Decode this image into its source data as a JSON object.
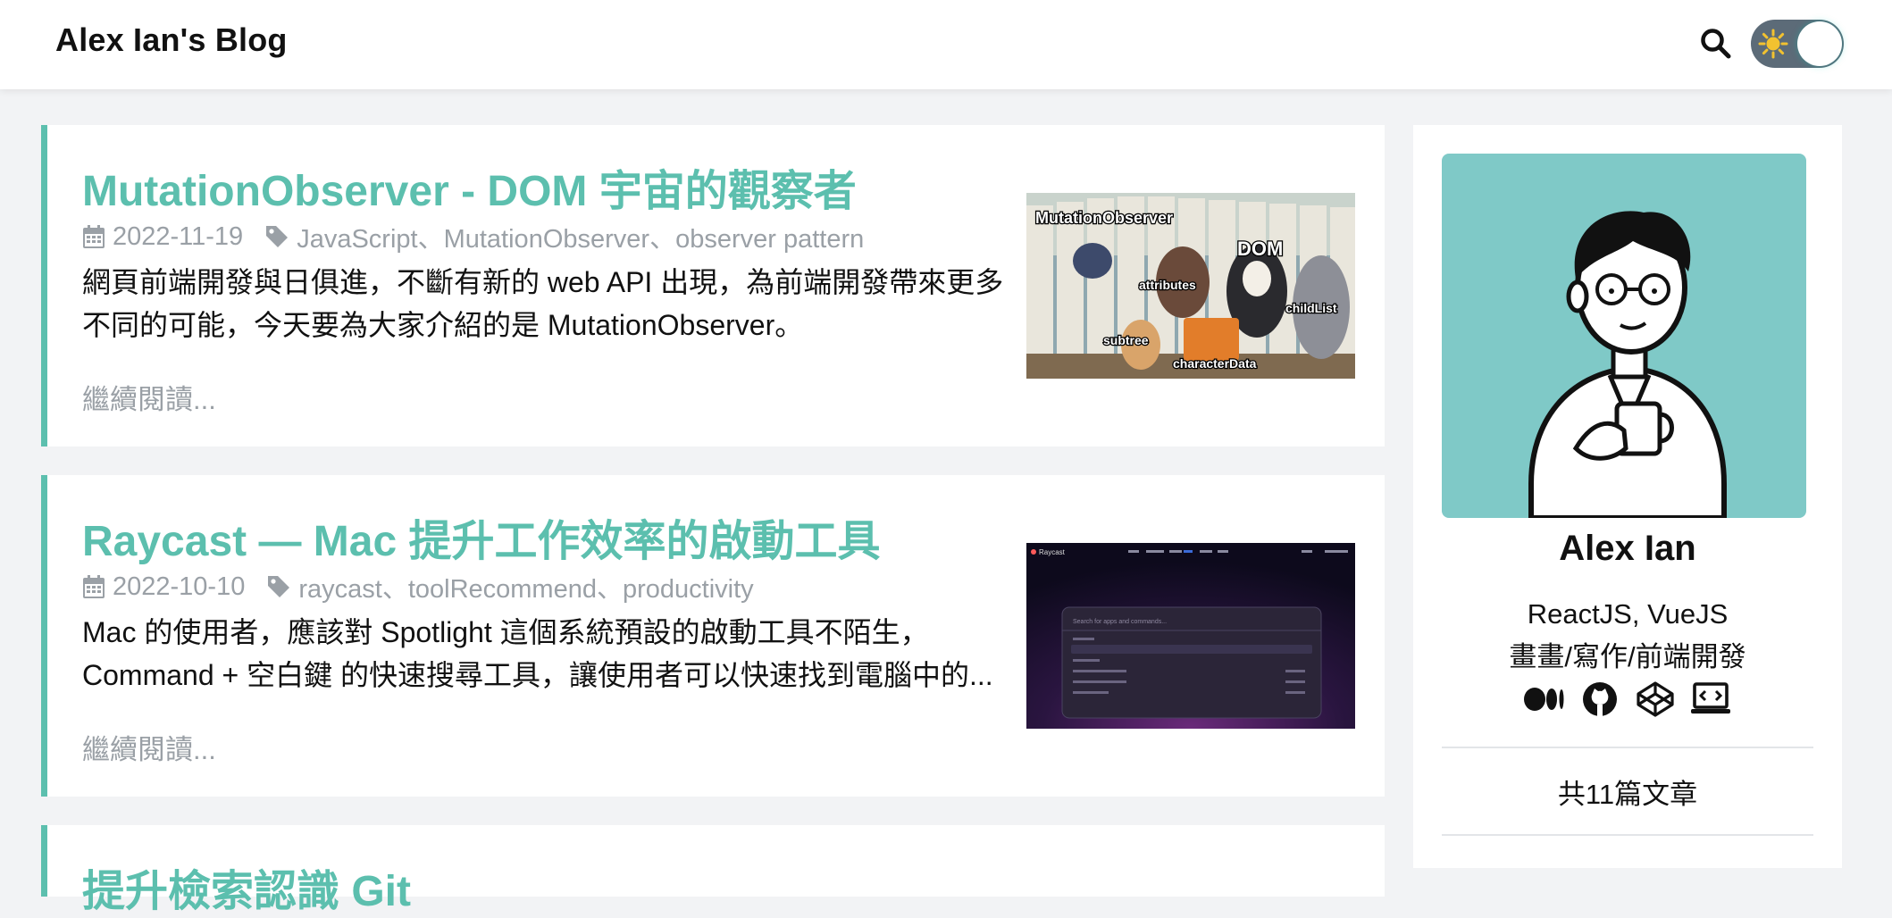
{
  "header": {
    "site_title": "Alex Ian's Blog",
    "theme_toggle_icon": "sun-icon"
  },
  "posts": [
    {
      "title": "MutationObserver - DOM 宇宙的觀察者",
      "date": "2022-11-19",
      "tags": "JavaScript、MutationObserver、observer pattern",
      "excerpt": "網頁前端開發與日俱進，不斷有新的 web API 出現，為前端開發帶來更多不同的可能，今天要為大家介紹的是 MutationObserver。",
      "read_more": "繼續閱讀...",
      "thumb_labels": {
        "a": "MutationObserver",
        "b": "DOM",
        "c": "attributes",
        "d": "childList",
        "e": "subtree",
        "f": "characterData"
      }
    },
    {
      "title": "Raycast — Mac 提升工作效率的啟動工具",
      "date": "2022-10-10",
      "tags": "raycast、toolRecommend、productivity",
      "excerpt": "Mac 的使用者，應該對 Spotlight 這個系統預設的啟動工具不陌生，Command + 空白鍵 的快速搜尋工具，讓使用者可以快速找到電腦中的...",
      "read_more": "繼續閱讀...",
      "thumb_labels": {
        "brand": "Raycast",
        "search": "Search for apps and commands..."
      }
    },
    {
      "title": "提升檢索認識 Git"
    }
  ],
  "sidebar": {
    "author_name": "Alex Ian",
    "bio_line1": "ReactJS, VueJS",
    "bio_line2": "畫畫/寫作/前端開發",
    "social": [
      "medium-icon",
      "github-icon",
      "codepen-icon",
      "portfolio-icon"
    ],
    "post_count": "共11篇文章"
  },
  "colors": {
    "accent": "#5cbfae",
    "muted": "#9aa0a6",
    "avatar_bg": "#7fc9c7"
  }
}
